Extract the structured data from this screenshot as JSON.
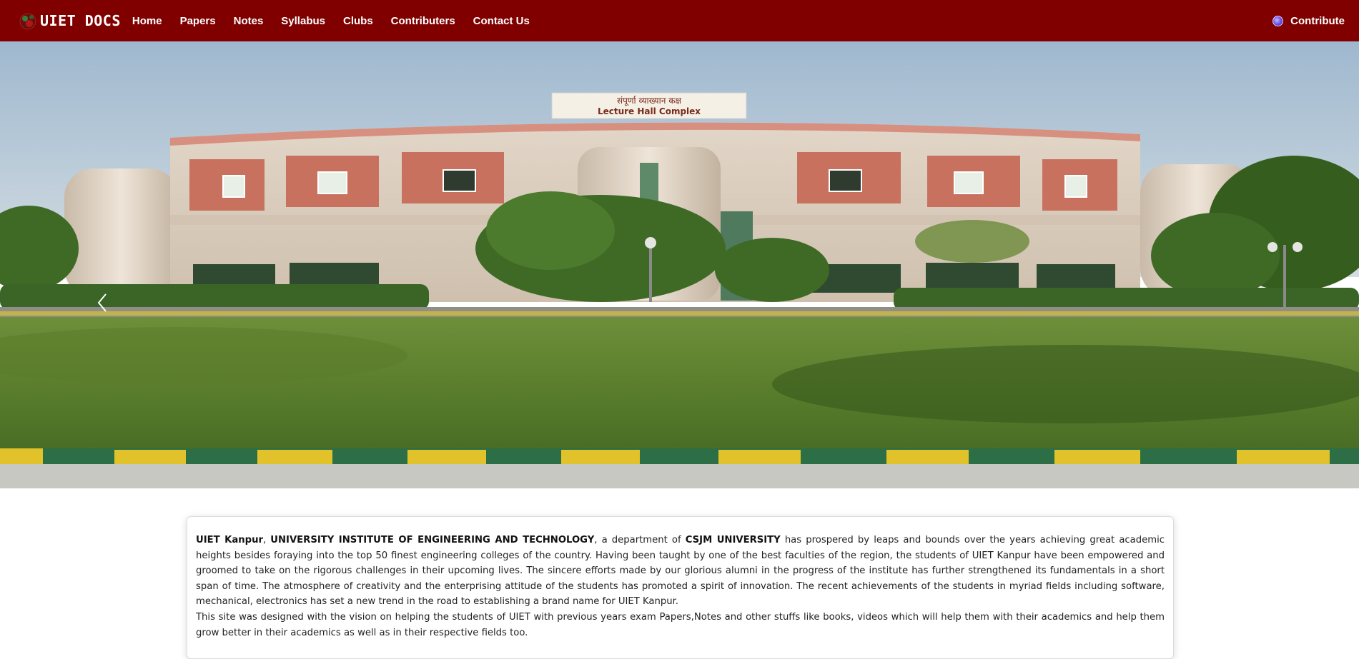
{
  "navbar": {
    "brand_name": "UIET DOCS",
    "links": [
      "Home",
      "Papers",
      "Notes",
      "Syllabus",
      "Clubs",
      "Contributers",
      "Contact Us"
    ],
    "contribute_label": "Contribute",
    "brand_icon": "uiet-logo-icon",
    "contribute_icon": "sparkle-icon",
    "background_color": "#800000"
  },
  "carousel": {
    "building_sign_hindi": "संपूर्णा व्याख्यान कक्ष",
    "building_sign_english": "Lecture Hall Complex",
    "prev_icon": "chevron-left-icon"
  },
  "about": {
    "p1_bold1": "UIET Kanpur",
    "p1_sep1": ", ",
    "p1_bold2": "UNIVERSITY INSTITUTE OF ENGINEERING AND TECHNOLOGY",
    "p1_text1": ", a department of ",
    "p1_bold3": "CSJM UNIVERSITY",
    "p1_text2": " has prospered by leaps and bounds over the years achieving great academic heights besides foraying into the top 50 finest engineering colleges of the country. Having been taught by one of the best faculties of the region, the students of UIET Kanpur have been empowered and groomed to take on the rigorous challenges in their upcoming lives. The sincere efforts made by our glorious alumni in the progress of the institute has further strengthened its fundamentals in a short span of time. The atmosphere of creativity and the enterprising attitude of the students has promoted a spirit of innovation. The recent achievements of the students in myriad fields including software, mechanical, electronics has set a new trend in the road to establishing a brand name for UIET Kanpur.",
    "p2": "This site was designed with the vision on helping the students of UIET with previous years exam Papers,Notes and other stuffs like books, videos which will help them with their academics and help them grow better in their academics as well as in their respective fields too."
  }
}
